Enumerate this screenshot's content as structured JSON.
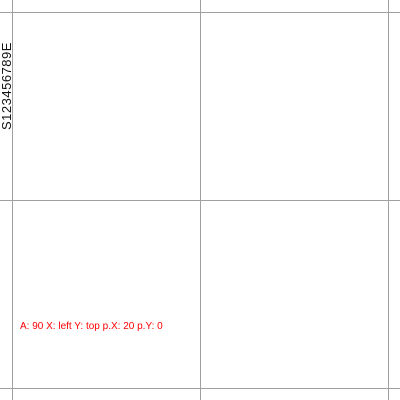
{
  "label": {
    "text": "S123456789E"
  },
  "readout": {
    "text": "A: 90 X: left Y: top p.X: 20 p.Y: 0",
    "color": "#ff0000"
  },
  "colors": {
    "grid": "#a0a0a0",
    "background": "#ffffff",
    "label": "#111111"
  }
}
